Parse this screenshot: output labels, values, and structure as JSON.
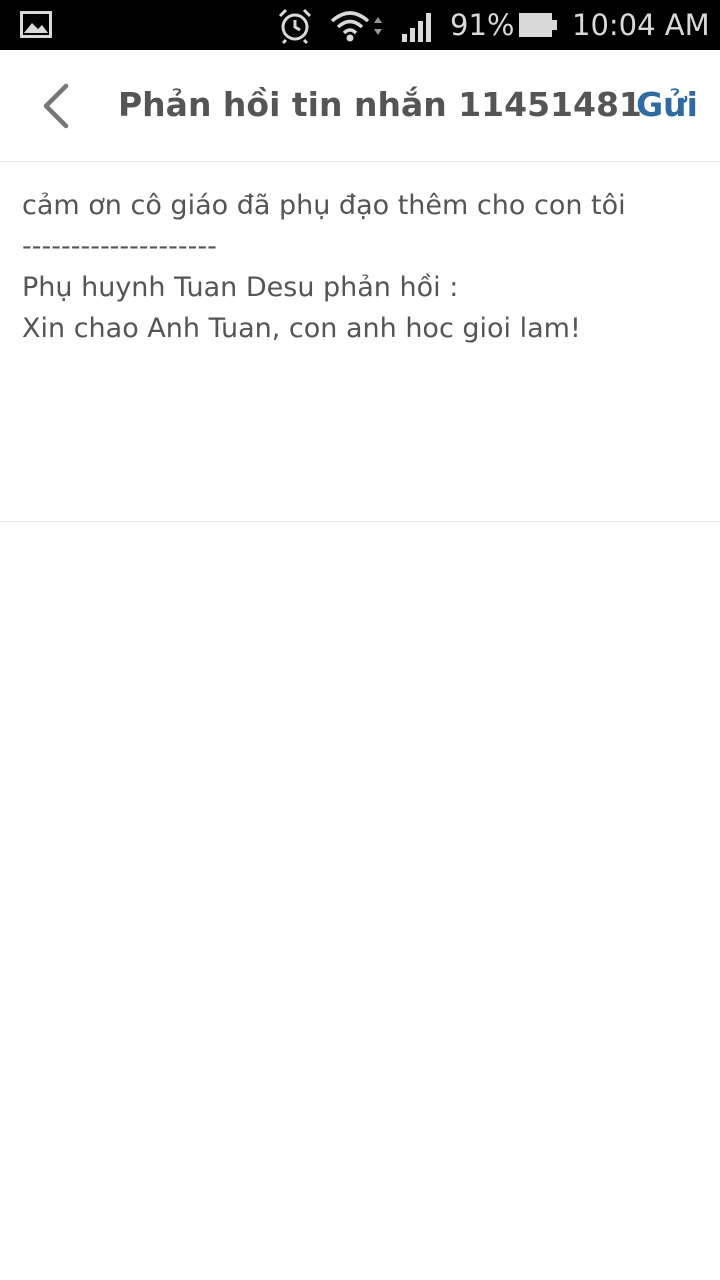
{
  "status_bar": {
    "battery_percent": "91%",
    "time": "10:04 AM",
    "icons": [
      "gallery-icon",
      "alarm-icon",
      "wifi-icon",
      "signal-icon",
      "battery-icon"
    ]
  },
  "header": {
    "back_icon": "chevron-left-icon",
    "title": "Phản hồi tin nhắn 11451481",
    "send_label": "Gửi",
    "colors": {
      "title": "#555555",
      "send": "#2f6aa1"
    }
  },
  "message": {
    "text": "cảm ơn cô giáo đã phụ đạo thêm cho con tôi\n--------------------\nPhụ huynh Tuan Desu phản hồi :\nXin chao Anh Tuan, con anh hoc gioi lam!"
  }
}
